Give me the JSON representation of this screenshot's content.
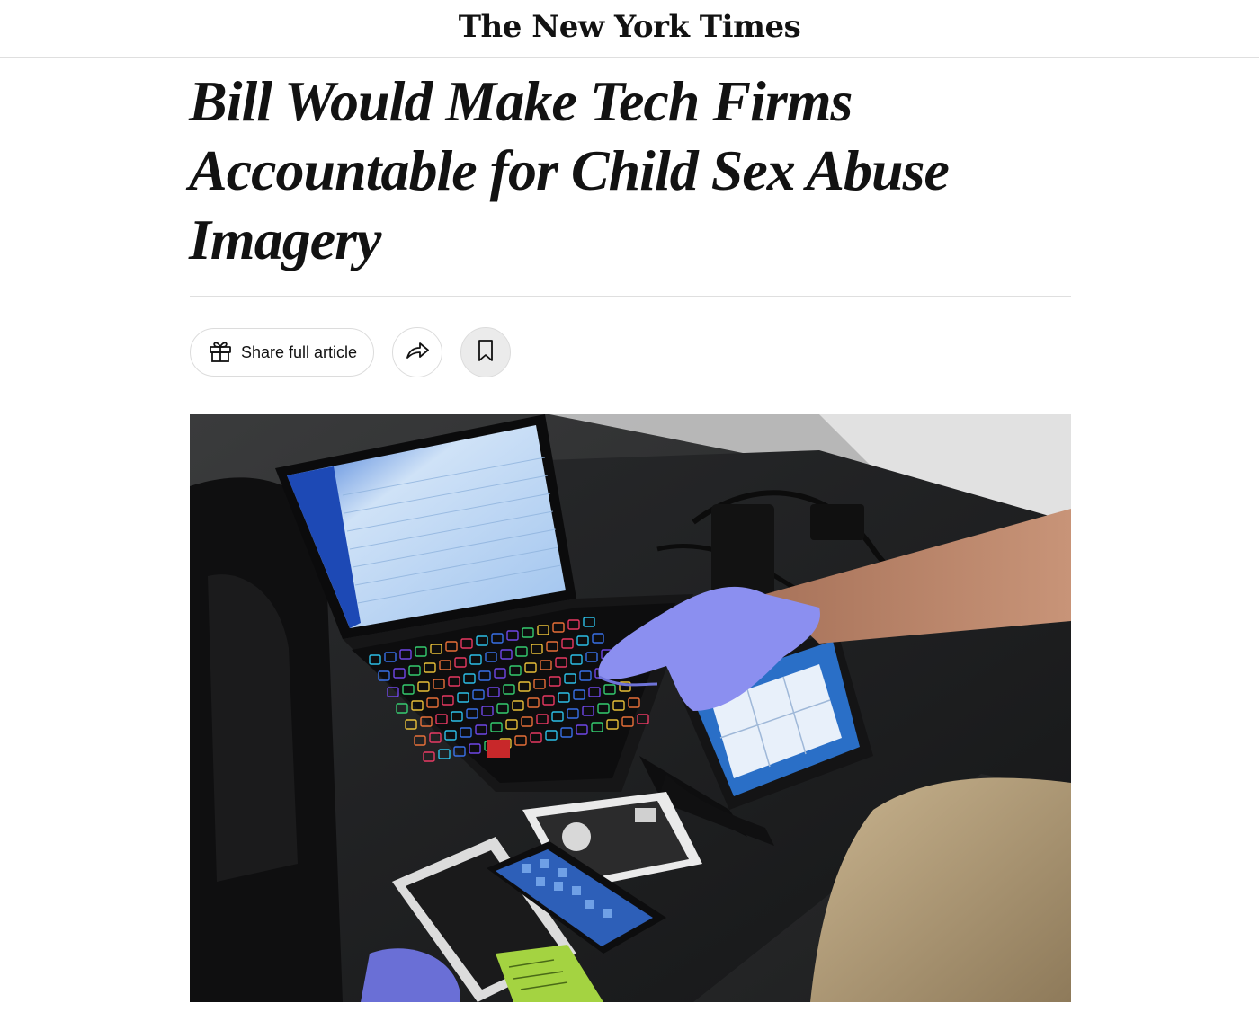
{
  "masthead": {
    "logo_text": "The New York Times"
  },
  "article": {
    "headline": "Bill Would Make Tech Firms Accountable for Child Sex Abuse Imagery"
  },
  "toolbar": {
    "share_full_article_label": "Share full article",
    "icons": [
      "gift-icon",
      "share-arrow-icon",
      "bookmark-icon"
    ]
  },
  "hero_image": {
    "description_icon": "photo",
    "keyboard_colors": [
      "#2fd3ff",
      "#3d7bff",
      "#7a4dff",
      "#38e07a",
      "#ffd23d",
      "#ff7a3d",
      "#ff3d6b"
    ]
  },
  "colors": {
    "text": "#121212",
    "rule": "#dfdfdf",
    "button_border": "#dcdcdc",
    "saved_bg": "#ebebeb"
  }
}
